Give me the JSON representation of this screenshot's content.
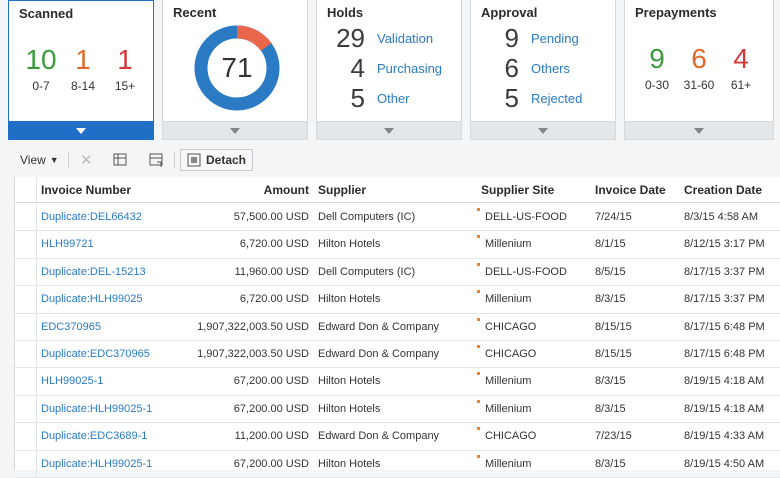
{
  "tiles": {
    "scanned": {
      "title": "Scanned",
      "buckets": [
        {
          "value": "10",
          "label": "0-7",
          "color": "#3b9b3b"
        },
        {
          "value": "1",
          "label": "8-14",
          "color": "#e06a2c"
        },
        {
          "value": "1",
          "label": "15+",
          "color": "#d23a3a"
        }
      ]
    },
    "recent": {
      "title": "Recent",
      "value": "71",
      "accent_fraction": 0.15
    },
    "holds": {
      "title": "Holds",
      "rows": [
        {
          "value": "29",
          "label": "Validation"
        },
        {
          "value": "4",
          "label": "Purchasing"
        },
        {
          "value": "5",
          "label": "Other"
        }
      ]
    },
    "approval": {
      "title": "Approval",
      "rows": [
        {
          "value": "9",
          "label": "Pending"
        },
        {
          "value": "6",
          "label": "Others"
        },
        {
          "value": "5",
          "label": "Rejected"
        }
      ]
    },
    "prepayments": {
      "title": "Prepayments",
      "buckets": [
        {
          "value": "9",
          "label": "0-30",
          "color": "#3b9b3b"
        },
        {
          "value": "6",
          "label": "31-60",
          "color": "#e06a2c"
        },
        {
          "value": "4",
          "label": "61+",
          "color": "#d23a3a"
        }
      ]
    }
  },
  "toolbar": {
    "view_label": "View",
    "detach_label": "Detach"
  },
  "table": {
    "headers": {
      "invoice_number": "Invoice Number",
      "amount": "Amount",
      "supplier": "Supplier",
      "supplier_site": "Supplier Site",
      "invoice_date": "Invoice Date",
      "creation_date": "Creation Date"
    },
    "rows": [
      {
        "invoice_number": "Duplicate:DEL66432",
        "amount": "57,500.00 USD",
        "supplier": "Dell Computers (IC)",
        "supplier_site": "DELL-US-FOOD",
        "invoice_date": "7/24/15",
        "creation_date": "8/3/15 4:58 AM"
      },
      {
        "invoice_number": "HLH99721",
        "amount": "6,720.00 USD",
        "supplier": "Hilton Hotels",
        "supplier_site": "Millenium",
        "invoice_date": "8/1/15",
        "creation_date": "8/12/15 3:17 PM"
      },
      {
        "invoice_number": "Duplicate:DEL-15213",
        "amount": "11,960.00 USD",
        "supplier": "Dell Computers (IC)",
        "supplier_site": "DELL-US-FOOD",
        "invoice_date": "8/5/15",
        "creation_date": "8/17/15 3:37 PM"
      },
      {
        "invoice_number": "Duplicate:HLH99025",
        "amount": "6,720.00 USD",
        "supplier": "Hilton Hotels",
        "supplier_site": "Millenium",
        "invoice_date": "8/3/15",
        "creation_date": "8/17/15 3:37 PM"
      },
      {
        "invoice_number": "EDC370965",
        "amount": "1,907,322,003.50 USD",
        "supplier": "Edward Don & Company",
        "supplier_site": "CHICAGO",
        "invoice_date": "8/15/15",
        "creation_date": "8/17/15 6:48 PM"
      },
      {
        "invoice_number": "Duplicate:EDC370965",
        "amount": "1,907,322,003.50 USD",
        "supplier": "Edward Don & Company",
        "supplier_site": "CHICAGO",
        "invoice_date": "8/15/15",
        "creation_date": "8/17/15 6:48 PM"
      },
      {
        "invoice_number": "HLH99025-1",
        "amount": "67,200.00 USD",
        "supplier": "Hilton Hotels",
        "supplier_site": "Millenium",
        "invoice_date": "8/3/15",
        "creation_date": "8/19/15 4:18 AM"
      },
      {
        "invoice_number": "Duplicate:HLH99025-1",
        "amount": "67,200.00 USD",
        "supplier": "Hilton Hotels",
        "supplier_site": "Millenium",
        "invoice_date": "8/3/15",
        "creation_date": "8/19/15 4:18 AM"
      },
      {
        "invoice_number": "Duplicate:EDC3689-1",
        "amount": "11,200.00 USD",
        "supplier": "Edward Don & Company",
        "supplier_site": "CHICAGO",
        "invoice_date": "7/23/15",
        "creation_date": "8/19/15 4:33 AM"
      },
      {
        "invoice_number": "Duplicate:HLH99025-1",
        "amount": "67,200.00 USD",
        "supplier": "Hilton Hotels",
        "supplier_site": "Millenium",
        "invoice_date": "8/3/15",
        "creation_date": "8/19/15 4:50 AM"
      }
    ]
  },
  "colors": {
    "accent": "#1f6fc7",
    "link": "#2a7bc4",
    "donut_main": "#2a7bc4",
    "donut_accent": "#e8664a"
  }
}
